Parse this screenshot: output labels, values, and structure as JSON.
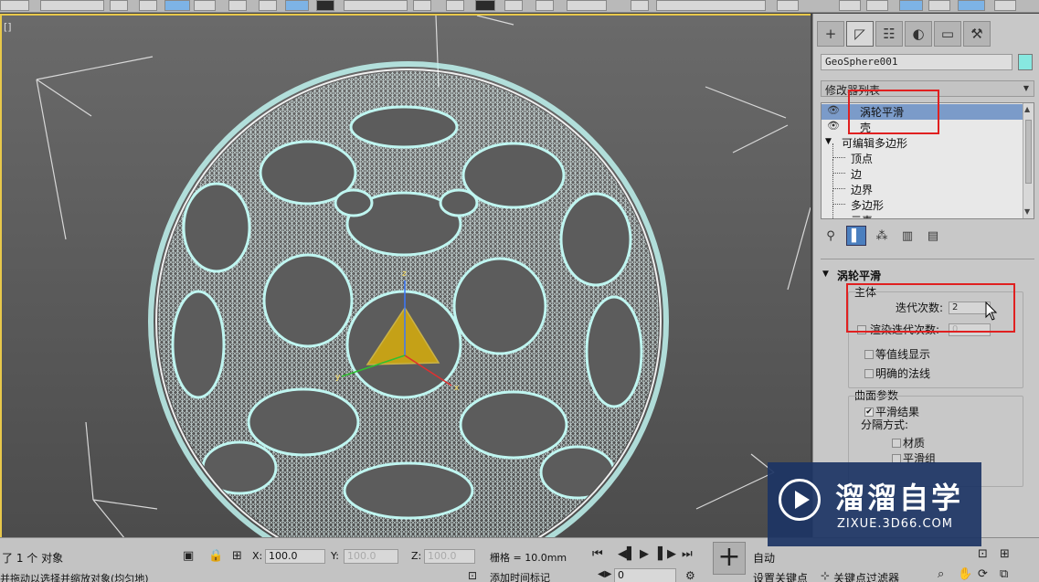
{
  "viewport": {
    "label": "[]"
  },
  "panel": {
    "tabs": [
      {
        "icon": "create-icon",
        "glyph": "+"
      },
      {
        "icon": "modify-icon",
        "glyph": "◸"
      },
      {
        "icon": "hierarchy-icon",
        "glyph": "☷"
      },
      {
        "icon": "motion-icon",
        "glyph": "◐"
      },
      {
        "icon": "display-icon",
        "glyph": "▭"
      },
      {
        "icon": "utilities-icon",
        "glyph": "🔧"
      }
    ],
    "object_name": "GeoSphere001",
    "object_color": "#87e8e0",
    "modifier_list": "修改器列表",
    "stack": {
      "turbosmooth": "涡轮平滑",
      "shell": "壳",
      "edit_poly": "可编辑多边形",
      "sub": [
        "顶点",
        "边",
        "边界",
        "多边形",
        "元素"
      ]
    },
    "stack_tools": [
      {
        "icon": "pin-stack-icon",
        "glyph": "📌"
      },
      {
        "icon": "show-end-result-icon",
        "glyph": "▌"
      },
      {
        "icon": "make-unique-icon",
        "glyph": "⁂"
      },
      {
        "icon": "remove-modifier-icon",
        "glyph": "🗑"
      },
      {
        "icon": "configure-sets-icon",
        "glyph": "▤"
      }
    ],
    "rollout": {
      "title": "涡轮平滑",
      "main": "主体",
      "iterations_label": "迭代次数:",
      "iterations_value": "2",
      "render_iters_label": "渲染迭代次数:",
      "render_iters_value": "0",
      "isoline": "等值线显示",
      "explicit_normals": "明确的法线",
      "surface_params": "曲面参数",
      "smooth_result": "平滑结果",
      "separate_by": "分隔方式:",
      "materials": "材质",
      "smoothing_groups": "平滑组"
    }
  },
  "status": {
    "selection": "了 1 个 对象",
    "hint": "并拖动以选择并缩放对象(均匀地)",
    "x_label": "X:",
    "x_value": "100.0",
    "y_label": "Y:",
    "y_value": "100.0",
    "z_label": "Z:",
    "z_value": "100.0",
    "grid": "栅格 = 10.0mm",
    "add_time_tag": "添加时间标记",
    "frame": "0",
    "auto_key": "自动",
    "set_key": "设置关键点",
    "key_filters": "关键点过滤器"
  },
  "watermark": {
    "title": "溜溜自学",
    "url": "ZIXUE.3D66.COM"
  },
  "colors": {
    "wire": "#bff5f0",
    "wire_bright": "#ffffff",
    "gizmo": "#e8b800",
    "highlight_box": "#e02020"
  }
}
